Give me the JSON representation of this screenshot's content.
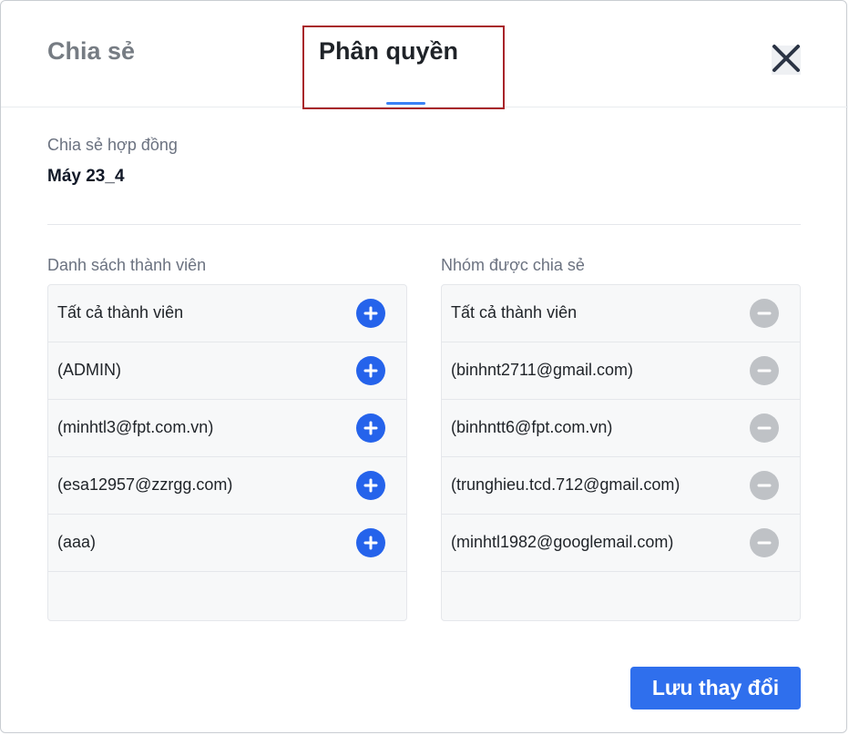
{
  "tabs": {
    "share_label": "Chia sẻ",
    "permission_label": "Phân quyền"
  },
  "contract": {
    "subtitle": "Chia sẻ hợp đồng",
    "name": "Máy 23_4"
  },
  "members": {
    "title": "Danh sách thành viên",
    "items": [
      {
        "label": "Tất cả thành viên"
      },
      {
        "label": "(ADMIN)"
      },
      {
        "label": "(minhtl3@fpt.com.vn)"
      },
      {
        "label": "(esa12957@zzrgg.com)"
      },
      {
        "label": "(aaa)"
      }
    ]
  },
  "shared_groups": {
    "title": "Nhóm được chia sẻ",
    "items": [
      {
        "label": "Tất cả thành viên"
      },
      {
        "label": "(binhnt2711@gmail.com)"
      },
      {
        "label": "(binhntt6@fpt.com.vn)"
      },
      {
        "label": "(trunghieu.tcd.712@gmail.com)"
      },
      {
        "label": "(minhtl1982@googlemail.com)"
      }
    ]
  },
  "footer": {
    "save_label": "Lưu thay đổi"
  },
  "colors": {
    "accent": "#2f6fed",
    "add_button": "#2563eb",
    "remove_button": "#bfc2c6",
    "highlight_border": "#a8242a"
  },
  "icons": {
    "close": "close-icon",
    "add": "plus-icon",
    "remove": "minus-icon"
  }
}
